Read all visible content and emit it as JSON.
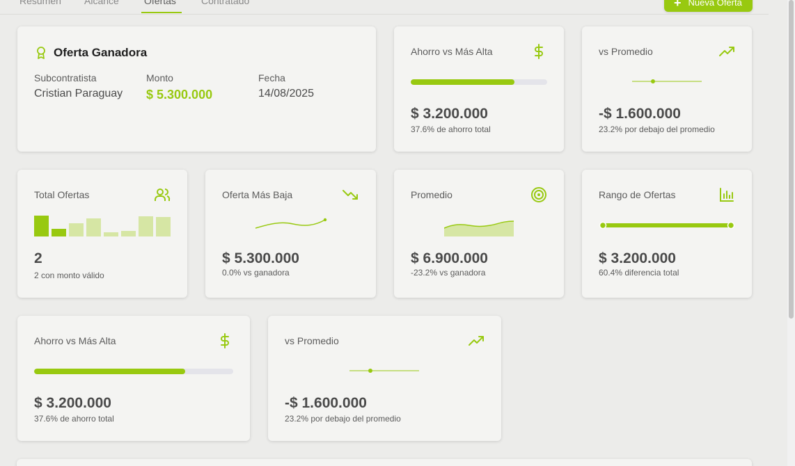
{
  "tabs": [
    {
      "label": "Resumen"
    },
    {
      "label": "Alcance"
    },
    {
      "label": "Ofertas"
    },
    {
      "label": "Contratado"
    }
  ],
  "new_offer_label": "Nueva Oferta",
  "winner": {
    "title": "Oferta Ganadora",
    "subcontractor_label": "Subcontratista",
    "subcontractor_value": "Cristian Paraguay",
    "amount_label": "Monto",
    "amount_value": "$ 5.300.000",
    "date_label": "Fecha",
    "date_value": "14/08/2025"
  },
  "savings_top": {
    "title": "Ahorro vs Más Alta",
    "progress": 0.76,
    "value": "$ 3.200.000",
    "sub": "37.6% de ahorro total"
  },
  "avg_top": {
    "title": "vs Promedio",
    "value": "-$ 1.600.000",
    "sub": "23.2% por debajo del promedio"
  },
  "total_offers": {
    "title": "Total Ofertas",
    "value": "2",
    "sub": "2 con monto válido"
  },
  "lowest": {
    "title": "Oferta Más Baja",
    "value": "$ 5.300.000",
    "sub": "0.0% vs ganadora"
  },
  "average": {
    "title": "Promedio",
    "value": "$ 6.900.000",
    "sub": "-23.2% vs ganadora"
  },
  "range": {
    "title": "Rango de Ofertas",
    "value": "$ 3.200.000",
    "sub": "60.4% diferencia total"
  },
  "savings_bottom": {
    "title": "Ahorro vs Más Alta",
    "progress": 0.76,
    "value": "$ 3.200.000",
    "sub": "37.6% de ahorro total"
  },
  "avg_bottom": {
    "title": "vs Promedio",
    "value": "-$ 1.600.000",
    "sub": "23.2% por debajo del promedio"
  },
  "colors": {
    "accent": "#98c910",
    "accent_light": "#d6e6a4"
  }
}
